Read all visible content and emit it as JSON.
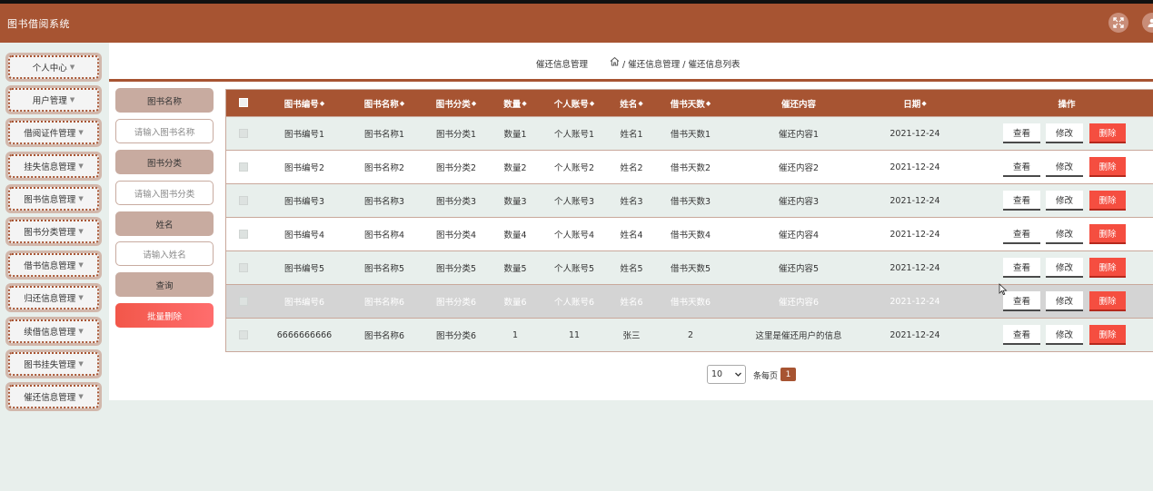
{
  "app": {
    "title": "图书借阅系统"
  },
  "colors": {
    "brand": "#a75432",
    "delete": "#f54e40",
    "row_alt": "#e8efec"
  },
  "header_icons": [
    "fullscreen-icon",
    "user-icon"
  ],
  "sidebar": {
    "items": [
      {
        "label": "个人中心"
      },
      {
        "label": "用户管理"
      },
      {
        "label": "借阅证件管理"
      },
      {
        "label": "挂失信息管理"
      },
      {
        "label": "图书信息管理"
      },
      {
        "label": "图书分类管理"
      },
      {
        "label": "借书信息管理"
      },
      {
        "label": "归还信息管理"
      },
      {
        "label": "续借信息管理"
      },
      {
        "label": "图书挂失管理"
      },
      {
        "label": "催还信息管理"
      }
    ]
  },
  "breadcrumb": {
    "title": "催还信息管理",
    "path": "/ 催还信息管理 / 催还信息列表"
  },
  "search": {
    "field1_label": "图书名称",
    "field1_placeholder": "请输入图书名称",
    "field2_label": "图书分类",
    "field2_placeholder": "请输入图书分类",
    "field3_label": "姓名",
    "field3_placeholder": "请输入姓名",
    "query_label": "查询",
    "batch_delete_label": "批量删除"
  },
  "table": {
    "columns": [
      "图书编号",
      "图书名称",
      "图书分类",
      "数量",
      "个人账号",
      "姓名",
      "借书天数",
      "催还内容",
      "日期",
      "操作"
    ],
    "actions": {
      "view": "查看",
      "edit": "修改",
      "delete": "删除"
    },
    "rows": [
      [
        "图书编号1",
        "图书名称1",
        "图书分类1",
        "数量1",
        "个人账号1",
        "姓名1",
        "借书天数1",
        "催还内容1",
        "2021-12-24"
      ],
      [
        "图书编号2",
        "图书名称2",
        "图书分类2",
        "数量2",
        "个人账号2",
        "姓名2",
        "借书天数2",
        "催还内容2",
        "2021-12-24"
      ],
      [
        "图书编号3",
        "图书名称3",
        "图书分类3",
        "数量3",
        "个人账号3",
        "姓名3",
        "借书天数3",
        "催还内容3",
        "2021-12-24"
      ],
      [
        "图书编号4",
        "图书名称4",
        "图书分类4",
        "数量4",
        "个人账号4",
        "姓名4",
        "借书天数4",
        "催还内容4",
        "2021-12-24"
      ],
      [
        "图书编号5",
        "图书名称5",
        "图书分类5",
        "数量5",
        "个人账号5",
        "姓名5",
        "借书天数5",
        "催还内容5",
        "2021-12-24"
      ],
      [
        "图书编号6",
        "图书名称6",
        "图书分类6",
        "数量6",
        "个人账号6",
        "姓名6",
        "借书天数6",
        "催还内容6",
        "2021-12-24"
      ],
      [
        "6666666666",
        "图书名称6",
        "图书分类6",
        "1",
        "11",
        "张三",
        "2",
        "这里是催还用户的信息",
        "2021-12-24"
      ]
    ]
  },
  "pagination": {
    "page_size": "10",
    "page_size_label": "条每页",
    "current_page": "1"
  }
}
